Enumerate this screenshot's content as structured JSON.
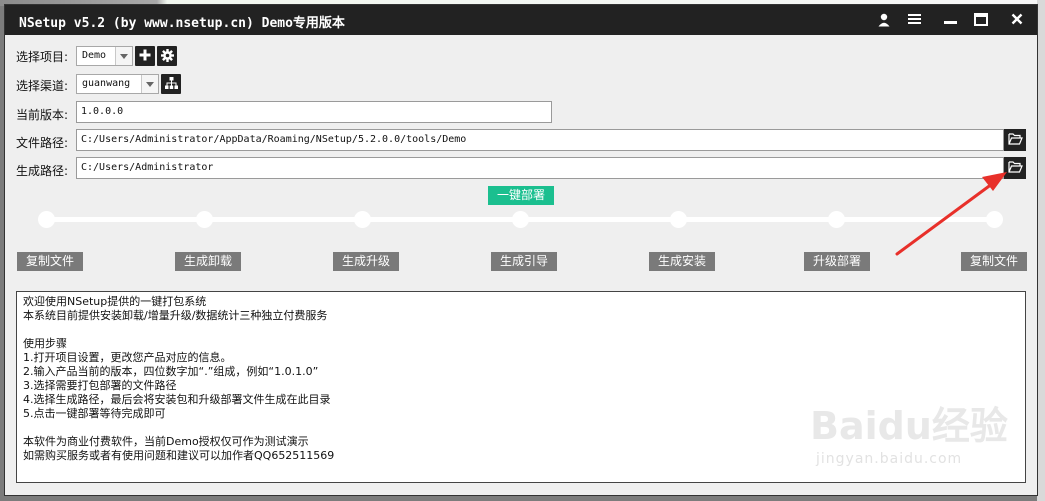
{
  "window": {
    "title": "NSetup v5.2 (by www.nsetup.cn) Demo专用版本",
    "buttons": [
      {
        "name": "user-icon"
      },
      {
        "name": "menu-icon"
      },
      {
        "name": "minimize-icon"
      },
      {
        "name": "maximize-icon"
      },
      {
        "name": "close-icon"
      }
    ]
  },
  "form": {
    "project_label": "选择项目:",
    "project_value": "Demo",
    "channel_label": "选择渠道:",
    "channel_value": "guanwang",
    "version_label": "当前版本:",
    "version_value": "1.0.0.0",
    "file_path_label": "文件路径:",
    "file_path_value": "C:/Users/Administrator/AppData/Roaming/NSetup/5.2.0.0/tools/Demo",
    "output_path_label": "生成路径:",
    "output_path_value": "C:/Users/Administrator"
  },
  "deploy_button": "一键部署",
  "steps": [
    "复制文件",
    "生成卸载",
    "生成升级",
    "生成引导",
    "生成安装",
    "升级部署",
    "复制文件"
  ],
  "log_lines": [
    "欢迎使用NSetup提供的一键打包系统",
    "本系统目前提供安装卸载/增量升级/数据统计三种独立付费服务",
    "",
    "使用步骤",
    "1.打开项目设置，更改您产品对应的信息。",
    "2.输入产品当前的版本，四位数字加“.”组成，例如“1.0.1.0”",
    "3.选择需要打包部署的文件路径",
    "4.选择生成路径，最后会将安装包和升级部署文件生成在此目录",
    "5.点击一键部署等待完成即可",
    "",
    "本软件为商业付费软件，当前Demo授权仅可作为测试演示",
    "如需购买服务或者有使用问题和建议可以加作者QQ652511569"
  ],
  "watermark": {
    "main": "Baidu经验",
    "sub": "jingyan.baidu.com"
  },
  "colors": {
    "titlebar": "#222222",
    "deploy_accent": "#1bbf8f",
    "step_button": "#7a7a7a",
    "annotation_arrow": "#e8302a"
  }
}
